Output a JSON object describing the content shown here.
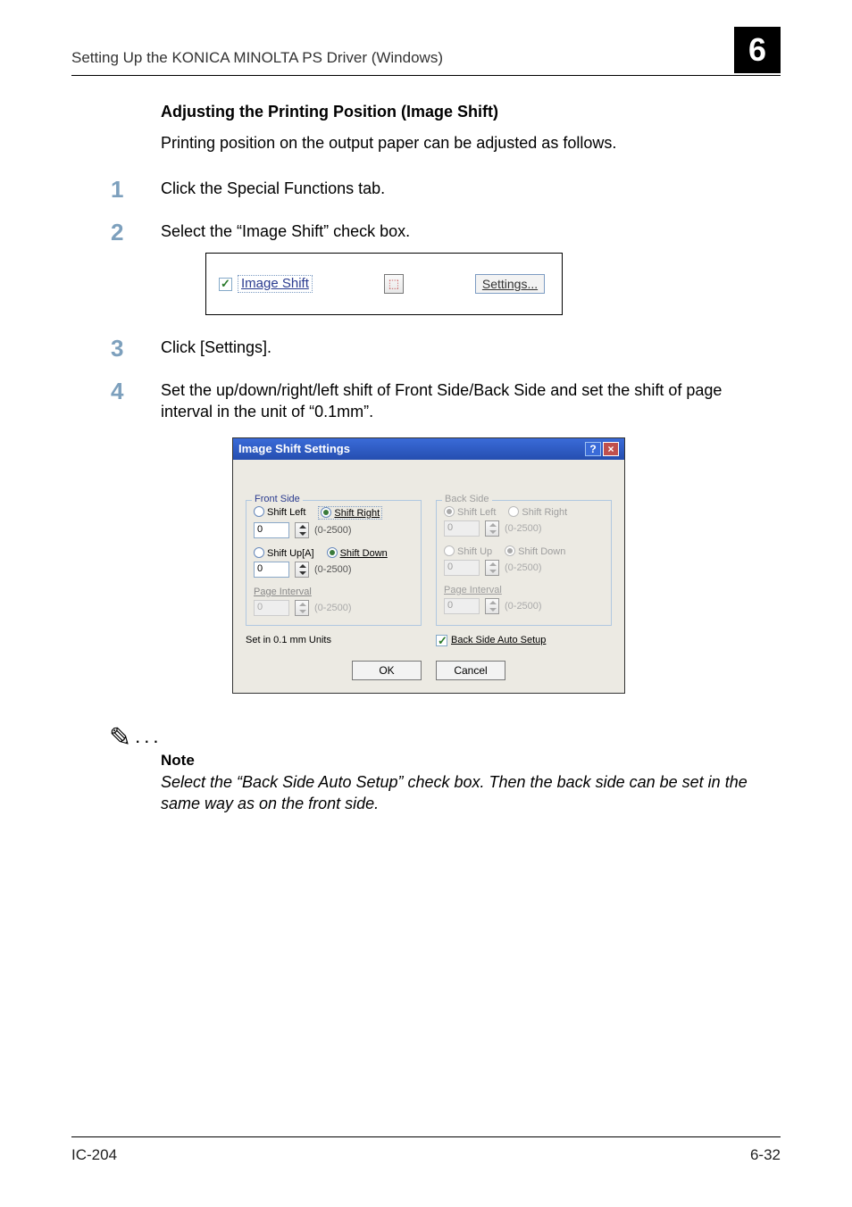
{
  "header": {
    "title": "Setting Up the KONICA MINOLTA PS Driver (Windows)",
    "chapter": "6"
  },
  "section": {
    "heading": "Adjusting the Printing Position (Image Shift)",
    "intro": "Printing position on the output paper can be adjusted as follows."
  },
  "steps": {
    "s1": {
      "num": "1",
      "text": "Click the Special Functions tab."
    },
    "s2": {
      "num": "2",
      "text": "Select the “Image Shift” check box."
    },
    "s3": {
      "num": "3",
      "text": "Click [Settings]."
    },
    "s4": {
      "num": "4",
      "text": "Set the up/down/right/left shift of Front Side/Back Side and set the shift of page interval in the unit of “0.1mm”."
    }
  },
  "checkbox_snippet": {
    "label": "Image Shift",
    "settings_button": "Settings..."
  },
  "dialog": {
    "title": "Image Shift Settings",
    "front": {
      "legend": "Front Side",
      "shift_left": "Shift Left",
      "shift_right": "Shift Right",
      "shift_up": "Shift Up[A]",
      "shift_down": "Shift Down",
      "value_h": "0",
      "value_v": "0",
      "range": "(0-2500)",
      "page_interval": "Page Interval",
      "page_value": "0",
      "page_range": "(0-2500)"
    },
    "back": {
      "legend": "Back Side",
      "shift_left": "Shift Left",
      "shift_right": "Shift Right",
      "shift_up": "Shift Up",
      "shift_down": "Shift Down",
      "value_h": "0",
      "value_v": "0",
      "range": "(0-2500)",
      "page_interval": "Page Interval",
      "page_value": "0",
      "page_range": "(0-2500)"
    },
    "units_note": "Set in 0.1 mm Units",
    "back_auto": "Back Side Auto Setup",
    "ok": "OK",
    "cancel": "Cancel"
  },
  "note": {
    "label": "Note",
    "text": "Select the “Back Side Auto Setup” check box. Then the back side can be set in the same way as on the front side."
  },
  "footer": {
    "left": "IC-204",
    "right": "6-32"
  }
}
